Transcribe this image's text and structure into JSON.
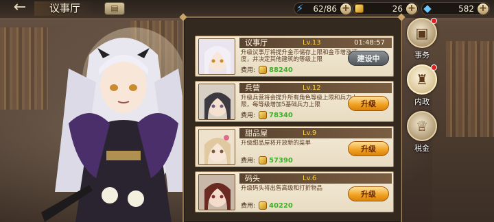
{
  "header": {
    "back_glyph": "←",
    "title": "议事厅",
    "wallet_icon": "wallet-icon"
  },
  "resources": [
    {
      "icon": "lightning-icon",
      "value": "62/86"
    },
    {
      "icon": "gold-coin-icon",
      "value": "26"
    },
    {
      "icon": "gem-icon",
      "value": "582"
    }
  ],
  "buildings": [
    {
      "name": "议事厅",
      "level": "Lv.13",
      "timer": "01:48:57",
      "desc": "升级议事厅将提升金币储存上限和金币增涨速度，并决定其他建筑的等级上限",
      "cost_label": "费用:",
      "cost": "88240",
      "button": "建设中",
      "status": "building"
    },
    {
      "name": "兵营",
      "level": "Lv.12",
      "timer": "",
      "desc": "升级兵营将会提升所有角色等级上限和兵力上限，每等级增加5基础兵力上限",
      "cost_label": "费用:",
      "cost": "78340",
      "button": "升级",
      "status": "upgrade"
    },
    {
      "name": "甜品屋",
      "level": "Lv.9",
      "timer": "",
      "desc": "升级甜品屋将开放新的菜单",
      "cost_label": "费用:",
      "cost": "57390",
      "button": "升级",
      "status": "upgrade"
    },
    {
      "name": "码头",
      "level": "Lv.6",
      "timer": "",
      "desc": "升级码头将出售高级和打折物品",
      "cost_label": "费用:",
      "cost": "40220",
      "button": "升级",
      "status": "upgrade"
    }
  ],
  "side_menu": [
    {
      "label": "事务",
      "icon": "scroll-icon",
      "active": false,
      "dot": true
    },
    {
      "label": "内政",
      "icon": "castle-icon",
      "active": true,
      "dot": true
    },
    {
      "label": "税金",
      "icon": "trophy-icon",
      "active": false,
      "dot": false
    }
  ],
  "colors": {
    "accent_gold": "#ffd24a",
    "cost_green": "#3fae2a",
    "upgrade_orange": "#f0a020",
    "panel_brown": "#34291f"
  }
}
